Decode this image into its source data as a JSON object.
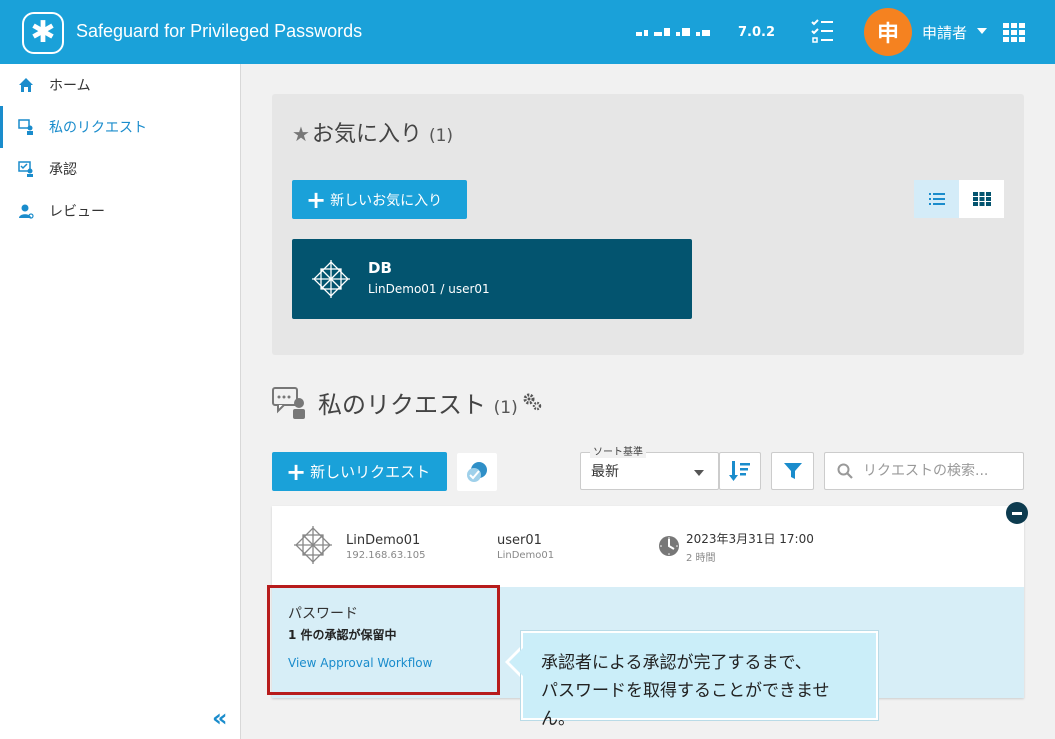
{
  "header": {
    "app_title": "Safeguard for Privileged Passwords",
    "version": "7.0.2",
    "avatar_initial": "申",
    "user_name": "申請者",
    "brand_color": "#1aa1d9",
    "avatar_color": "#f58220"
  },
  "sidebar": {
    "items": [
      {
        "label": "ホーム",
        "icon": "home-icon"
      },
      {
        "label": "私のリクエスト",
        "icon": "my-requests-icon"
      },
      {
        "label": "承認",
        "icon": "approval-icon"
      },
      {
        "label": "レビュー",
        "icon": "review-icon"
      }
    ],
    "active_index": 1,
    "collapse_glyph": "«"
  },
  "favorites": {
    "title": "お気に入り",
    "count": "(1)",
    "new_button": "新しいお気に入り",
    "cards": [
      {
        "name": "DB",
        "subtitle": "LinDemo01 / user01"
      }
    ]
  },
  "requests": {
    "title": "私のリクエスト",
    "count": "(1)",
    "new_button": "新しいリクエスト",
    "sort_label": "ソート基準",
    "sort_value": "最新",
    "search_placeholder": "リクエストの検索...",
    "items": [
      {
        "asset_name": "LinDemo01",
        "asset_ip": "192.168.63.105",
        "account_name": "user01",
        "account_asset": "LinDemo01",
        "date": "2023年3月31日 17:00",
        "duration": "2 時間",
        "access_type": "パスワード",
        "status": "1 件の承認が保留中",
        "workflow_link": "View Approval Workflow"
      }
    ]
  },
  "tooltip": {
    "line1": "承認者による承認が完了するまで、",
    "line2": "パスワードを取得することができません。"
  }
}
